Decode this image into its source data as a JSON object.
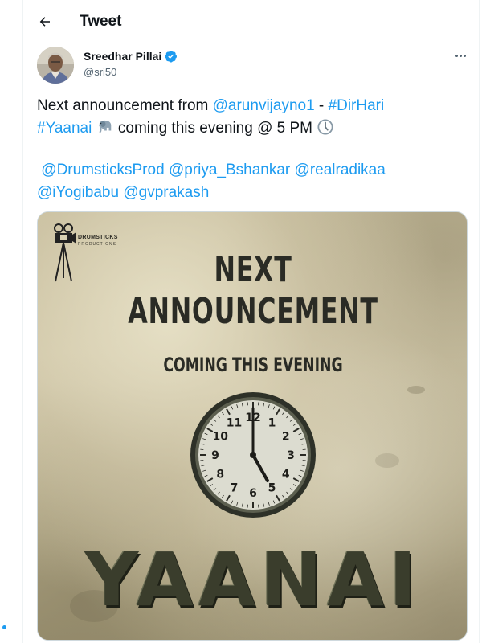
{
  "header": {
    "back_icon": "arrow-left-icon",
    "title": "Tweet"
  },
  "author": {
    "name": "Sreedhar Pillai",
    "handle": "@sri50",
    "verified": true,
    "verified_color": "#1d9bf0"
  },
  "more_icon": "more-horizontal-icon",
  "tweet": {
    "part1": "Next announcement from ",
    "mention1": "@arunvijayno1",
    "part2": " - ",
    "hashtag1": "#DirHari",
    "hashtag2": "#Yaanai",
    "part3": " coming this evening @ 5 PM",
    "emoji1": "elephant-emoji",
    "emoji2": "clock-emoji",
    "mentions": [
      "@DrumsticksProd",
      "@priya_Bshankar",
      "@realradikaa",
      "@iYogibabu",
      "@gvprakash"
    ]
  },
  "poster": {
    "production_name": "DRUMSTICKS",
    "production_sub": "PRODUCTIONS",
    "line1": "NEXT",
    "line2": "ANNOUNCEMENT",
    "line3": "COMING THIS EVENING",
    "clock_numbers": [
      "12",
      "1",
      "2",
      "3",
      "4",
      "5",
      "6",
      "7",
      "8",
      "9",
      "10",
      "11"
    ],
    "title": "YAANAI"
  },
  "colors": {
    "link": "#1d9bf0",
    "text": "#0f1419",
    "secondary": "#536471"
  }
}
